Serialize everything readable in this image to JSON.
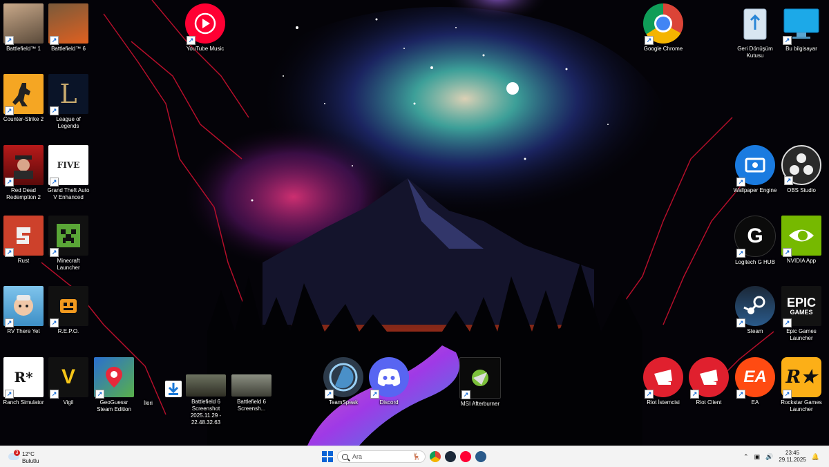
{
  "desktop": {
    "icons": [
      {
        "label": "Battlefield™ 1"
      },
      {
        "label": "Battlefield™ 6"
      },
      {
        "label": "YouTube Music"
      },
      {
        "label": "Google Chrome"
      },
      {
        "label": "Geri Dönüşüm Kutusu"
      },
      {
        "label": "Bu bilgisayar"
      },
      {
        "label": "Counter-Strike 2"
      },
      {
        "label": "League of Legends"
      },
      {
        "label": "Red Dead Redemption 2"
      },
      {
        "label": "Grand Theft Auto V Enhanced"
      },
      {
        "label": "Wallpaper Engine"
      },
      {
        "label": "OBS Studio"
      },
      {
        "label": "Rust"
      },
      {
        "label": "Minecraft Launcher"
      },
      {
        "label": "Logitech G HUB"
      },
      {
        "label": "NVIDIA App"
      },
      {
        "label": "RV There Yet"
      },
      {
        "label": "R.E.P.O."
      },
      {
        "label": "Steam"
      },
      {
        "label": "Epic Games Launcher"
      },
      {
        "label": "Ranch Simulator"
      },
      {
        "label": "Vigil"
      },
      {
        "label": "GeoGuessr Steam Edition"
      },
      {
        "label": "İleri"
      },
      {
        "label": "Battlefield 6 Screenshot 2025.11.29 - 22.48.32.63"
      },
      {
        "label": "Battlefield 6 Screensh..."
      },
      {
        "label": "TeamSpeak"
      },
      {
        "label": "Discord"
      },
      {
        "label": "MSI Afterburner"
      },
      {
        "label": "Riot İstemcisi"
      },
      {
        "label": "Riot Client"
      },
      {
        "label": "EA"
      },
      {
        "label": "Rockstar Games Launcher"
      }
    ],
    "tile_text": {
      "lol": "L",
      "gta": "FIVE",
      "epic": "EPIC",
      "epic_sub": "GAMES",
      "rs": "R*",
      "vigil": "V",
      "ea": "EA",
      "rockstar": "R★",
      "logitech": "G"
    }
  },
  "taskbar": {
    "weather": {
      "temp": "12°C",
      "condition": "Bulutlu",
      "badge": "3"
    },
    "search": {
      "placeholder": "Ara"
    },
    "clock": {
      "time": "23:45",
      "date": "29.11.2025"
    }
  },
  "colors": {
    "start": "#0a64d6",
    "youtube_music": "#ff0033",
    "discord": "#5865f2",
    "riot": "#e0202e",
    "ea": "#ff4b12",
    "rockstar": "#fcaf17",
    "nvidia": "#76b900",
    "steam": "#1b2838"
  }
}
